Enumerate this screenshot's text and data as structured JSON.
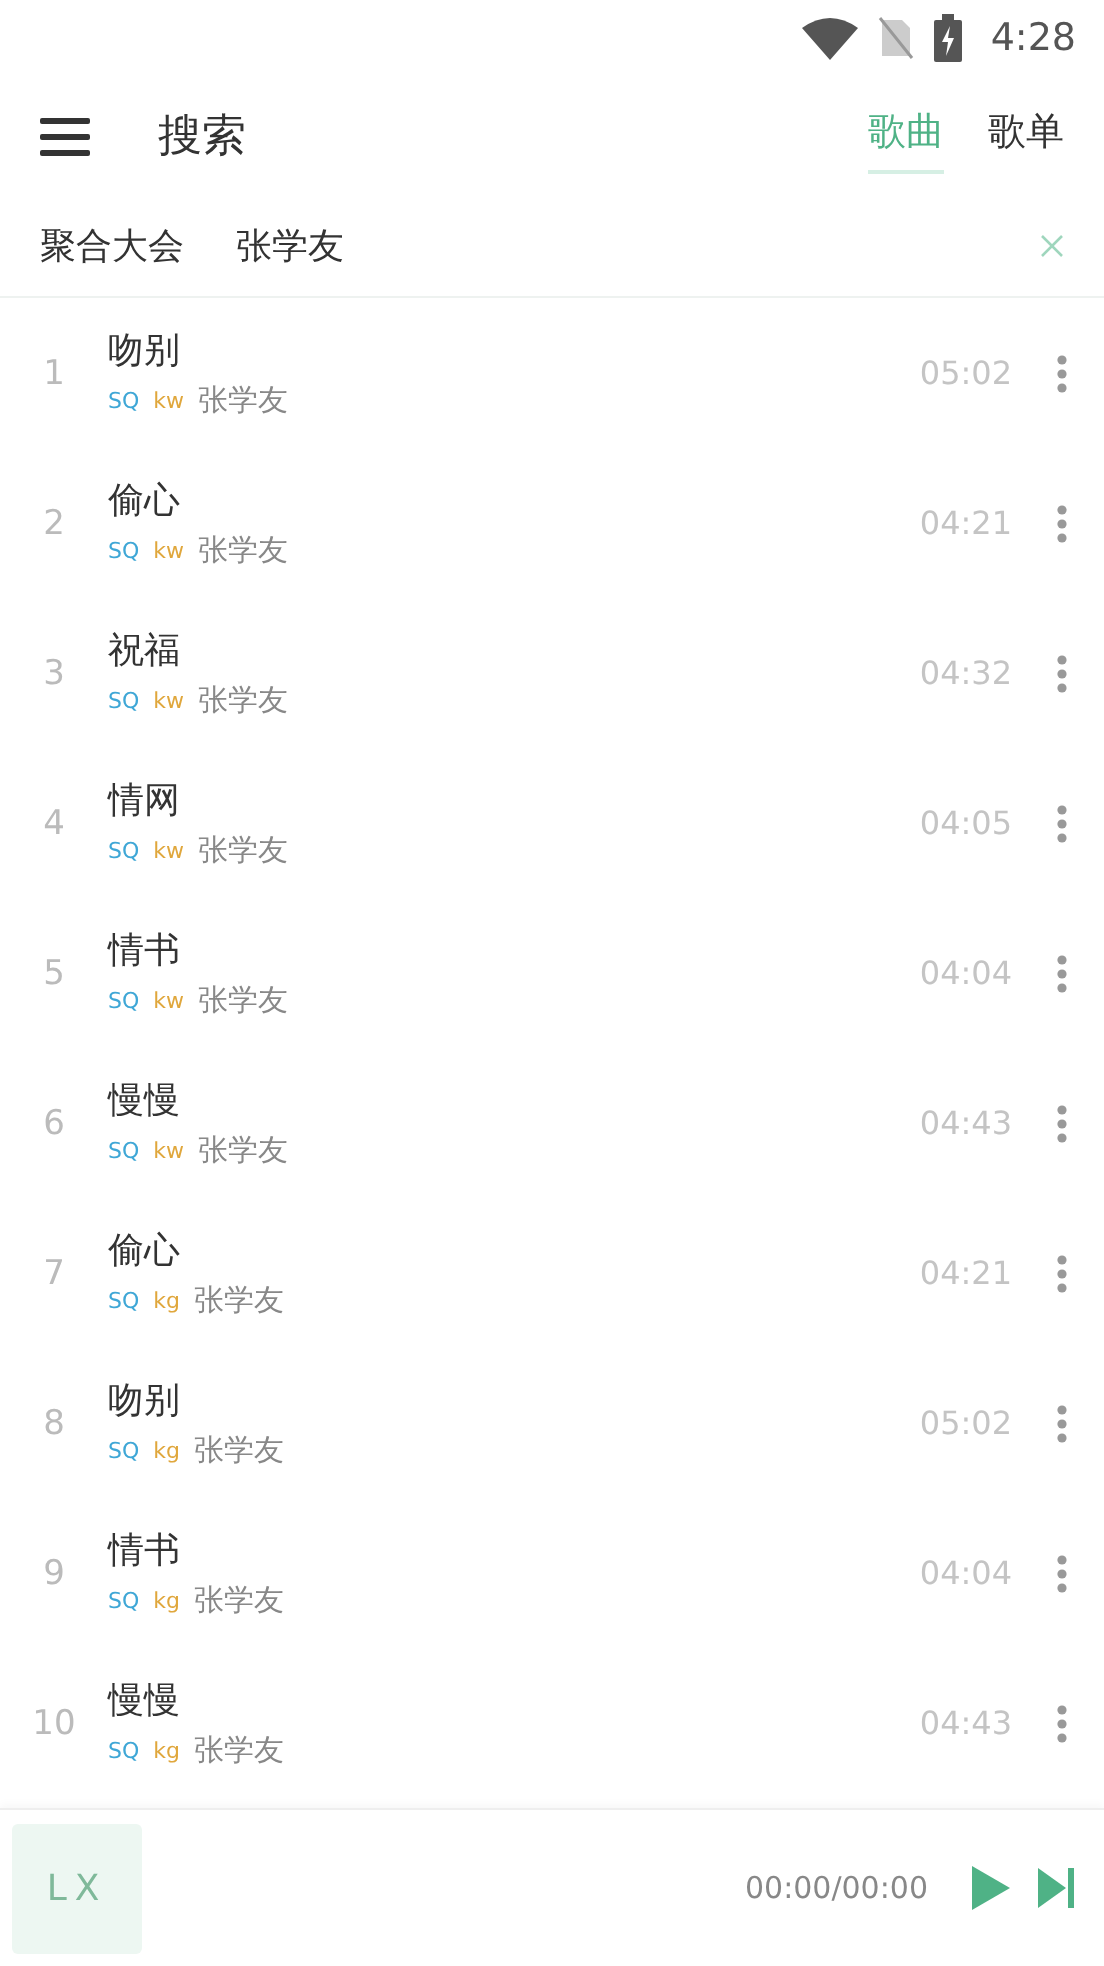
{
  "status_bar": {
    "time": "4:28"
  },
  "header": {
    "title": "搜索",
    "tabs": [
      {
        "label": "歌曲",
        "selected": true
      },
      {
        "label": "歌单",
        "selected": false
      }
    ]
  },
  "sources": [
    {
      "label": "聚合大会"
    },
    {
      "label": "张学友"
    }
  ],
  "songs": [
    {
      "index": "1",
      "title": "吻别",
      "quality": "SQ",
      "source": "kw",
      "artist": "张学友",
      "duration": "05:02"
    },
    {
      "index": "2",
      "title": "偷心",
      "quality": "SQ",
      "source": "kw",
      "artist": "张学友",
      "duration": "04:21"
    },
    {
      "index": "3",
      "title": "祝福",
      "quality": "SQ",
      "source": "kw",
      "artist": "张学友",
      "duration": "04:32"
    },
    {
      "index": "4",
      "title": "情网",
      "quality": "SQ",
      "source": "kw",
      "artist": "张学友",
      "duration": "04:05"
    },
    {
      "index": "5",
      "title": "情书",
      "quality": "SQ",
      "source": "kw",
      "artist": "张学友",
      "duration": "04:04"
    },
    {
      "index": "6",
      "title": "慢慢",
      "quality": "SQ",
      "source": "kw",
      "artist": "张学友",
      "duration": "04:43"
    },
    {
      "index": "7",
      "title": "偷心",
      "quality": "SQ",
      "source": "kg",
      "artist": "张学友",
      "duration": "04:21"
    },
    {
      "index": "8",
      "title": "吻别",
      "quality": "SQ",
      "source": "kg",
      "artist": "张学友",
      "duration": "05:02"
    },
    {
      "index": "9",
      "title": "情书",
      "quality": "SQ",
      "source": "kg",
      "artist": "张学友",
      "duration": "04:04"
    },
    {
      "index": "10",
      "title": "慢慢",
      "quality": "SQ",
      "source": "kg",
      "artist": "张学友",
      "duration": "04:43"
    }
  ],
  "player": {
    "cover": "LX",
    "time": "00:00/00:00"
  }
}
